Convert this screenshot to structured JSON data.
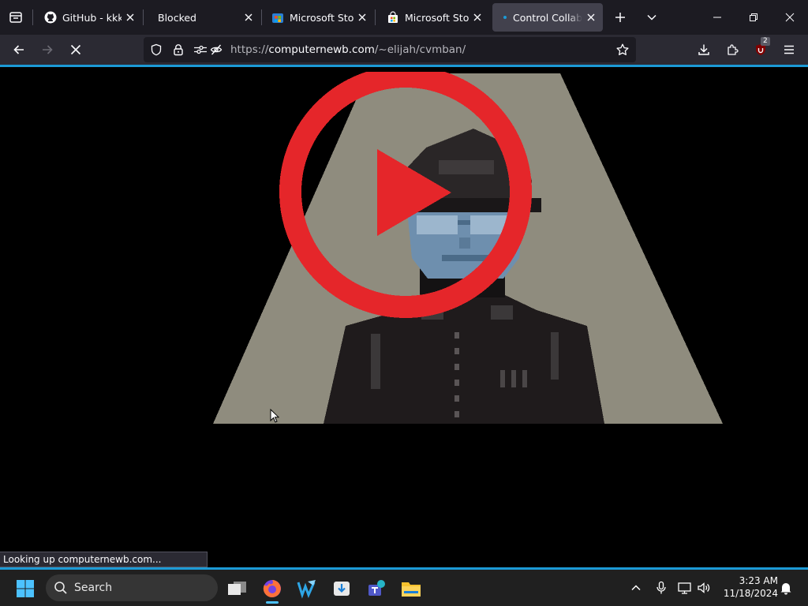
{
  "tabs": [
    {
      "title": "GitHub - kkkgo/",
      "favicon": "github-icon"
    },
    {
      "title": "Blocked",
      "favicon": ""
    },
    {
      "title": "Microsoft Store",
      "favicon": "microsoft-store-icon"
    },
    {
      "title": "Microsoft Store",
      "favicon": "microsoft-store-bag-icon"
    },
    {
      "title": "Control Collabo",
      "favicon": "loading-dot-icon",
      "active": true
    }
  ],
  "address_bar": {
    "url_prefix": "https://",
    "url_host": "computernewb.com",
    "url_path": "/~elijah/cvmban/"
  },
  "extension_badge": "2",
  "status_text": "Looking up computernewb.com...",
  "taskbar": {
    "search_label": "Search",
    "apps": [
      "task-view-icon",
      "firefox-icon",
      "wing-ide-icon",
      "installer-icon",
      "teams-icon",
      "file-explorer-icon"
    ]
  },
  "clock": {
    "time": "3:23 AM",
    "date": "11/18/2024"
  },
  "colors": {
    "accent": "#1c9ad6",
    "play_red": "#e5262a",
    "art_beige": "#8f8c7e"
  }
}
